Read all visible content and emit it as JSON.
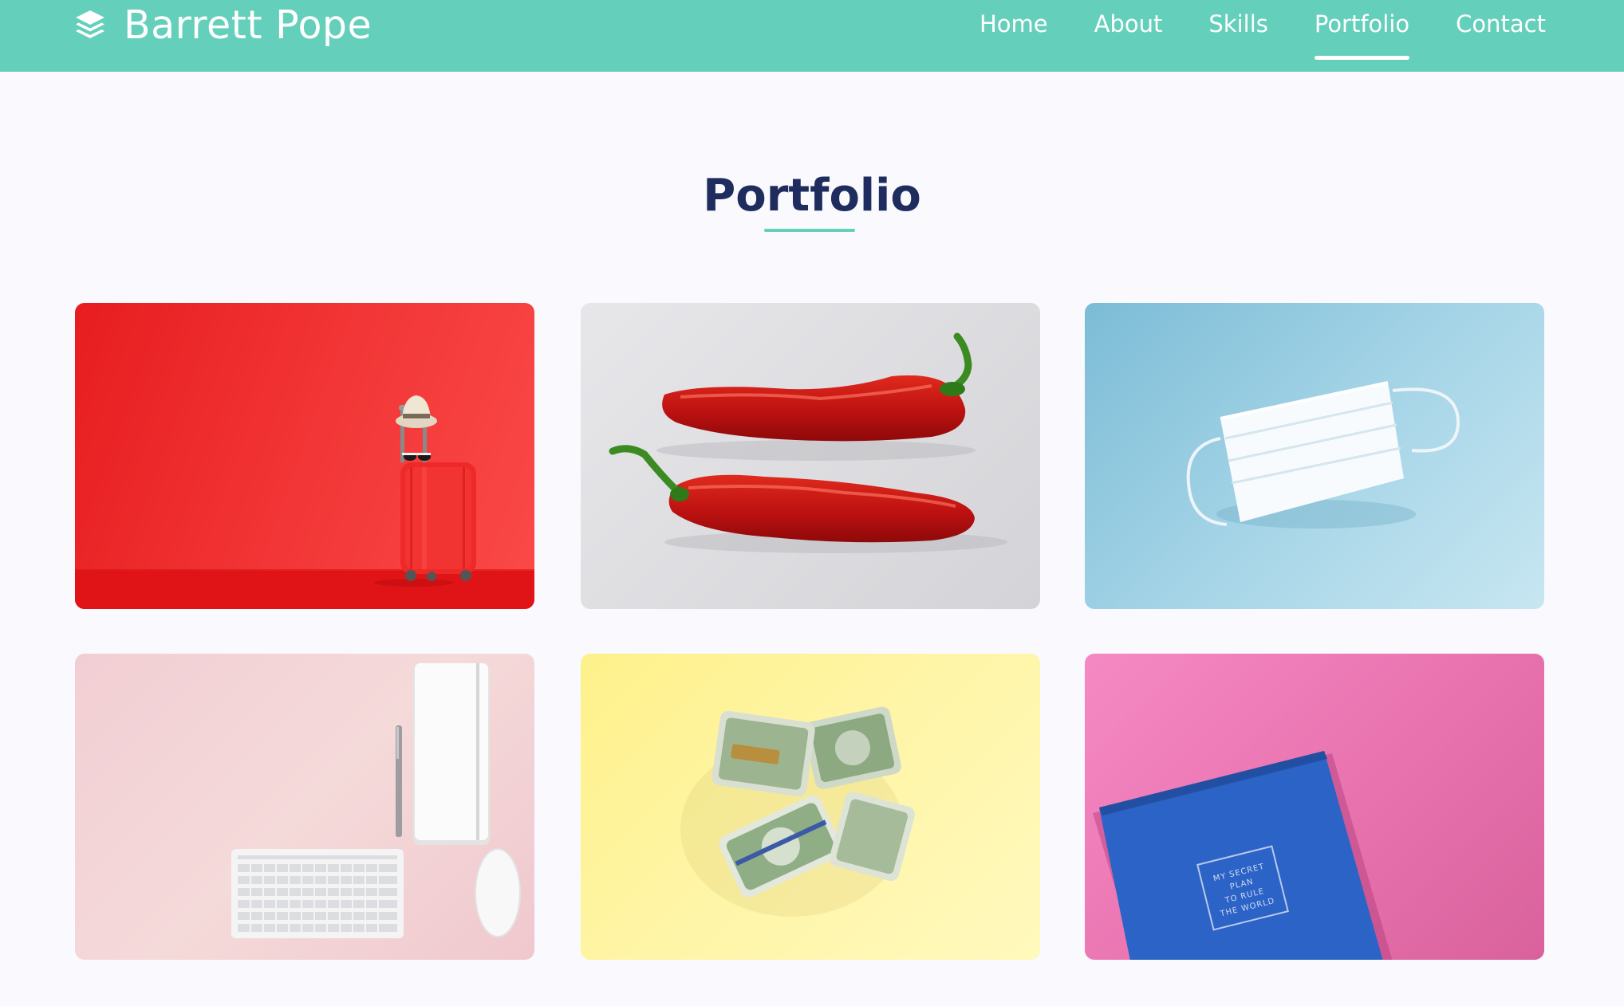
{
  "brand": {
    "name": "Barrett Pope",
    "icon": "layers-icon"
  },
  "nav": {
    "items": [
      {
        "label": "Home"
      },
      {
        "label": "About"
      },
      {
        "label": "Skills"
      },
      {
        "label": "Portfolio"
      },
      {
        "label": "Contact"
      }
    ],
    "active": "Portfolio"
  },
  "portfolio": {
    "title": "Portfolio",
    "items": [
      {
        "image": "red-suitcase-photo"
      },
      {
        "image": "red-peppers-photo"
      },
      {
        "image": "face-mask-photo"
      },
      {
        "image": "keyboard-notebook-photo"
      },
      {
        "image": "money-rolls-photo"
      },
      {
        "image": "blue-notebook-photo",
        "cover_text": [
          "MY SECRET",
          "PLAN",
          "TO RULE",
          "THE WORLD"
        ]
      }
    ]
  },
  "colors": {
    "header": "#64cfba",
    "accent": "#64cfba",
    "title": "#1f2d5e",
    "background": "#f9f9fe"
  }
}
